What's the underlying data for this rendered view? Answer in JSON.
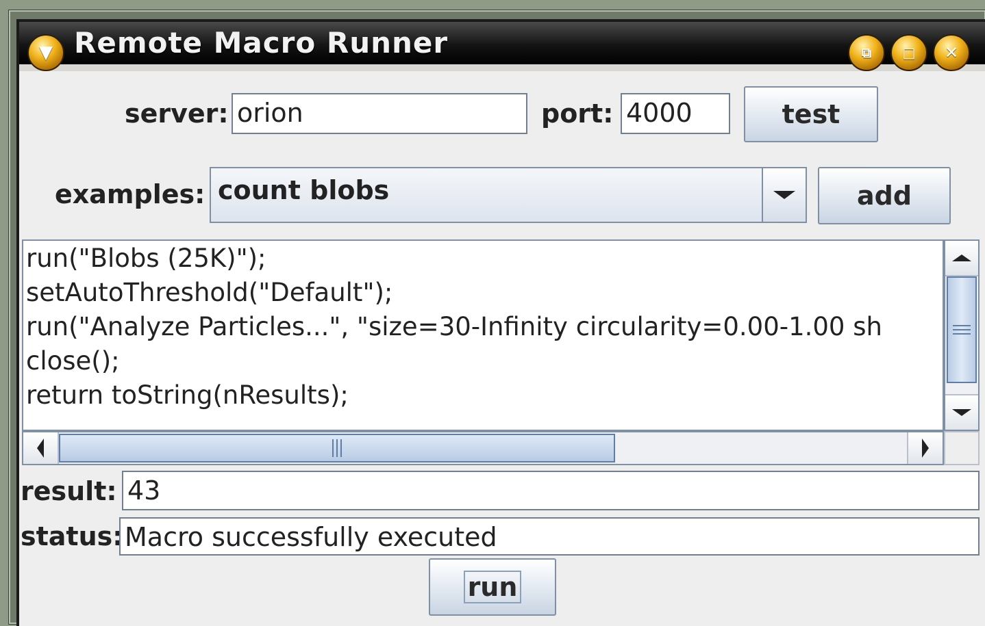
{
  "window": {
    "title": "Remote Macro Runner",
    "menu_icon": "chevron-down-icon",
    "controls": [
      "restore-icon",
      "maximize-icon",
      "close-icon"
    ]
  },
  "server": {
    "label": "server:",
    "value": "orion"
  },
  "port": {
    "label": "port:",
    "value": "4000"
  },
  "test_button": "test",
  "examples": {
    "label": "examples:",
    "selected": "count blobs"
  },
  "add_button": "add",
  "macro": {
    "lines": [
      "run(\"Blobs (25K)\");",
      "setAutoThreshold(\"Default\");",
      "run(\"Analyze Particles...\", \"size=30-Infinity circularity=0.00-1.00 sh",
      "close();",
      "return toString(nResults);"
    ]
  },
  "result": {
    "label": "result:",
    "value": "43"
  },
  "status": {
    "label": "status:",
    "value": "Macro successfully executed"
  },
  "run_button": "run",
  "colors": {
    "accent_orb": "#f2b31b",
    "titlebar": "#141414",
    "panel": "#eeeeee",
    "border": "#7f8fa4"
  }
}
